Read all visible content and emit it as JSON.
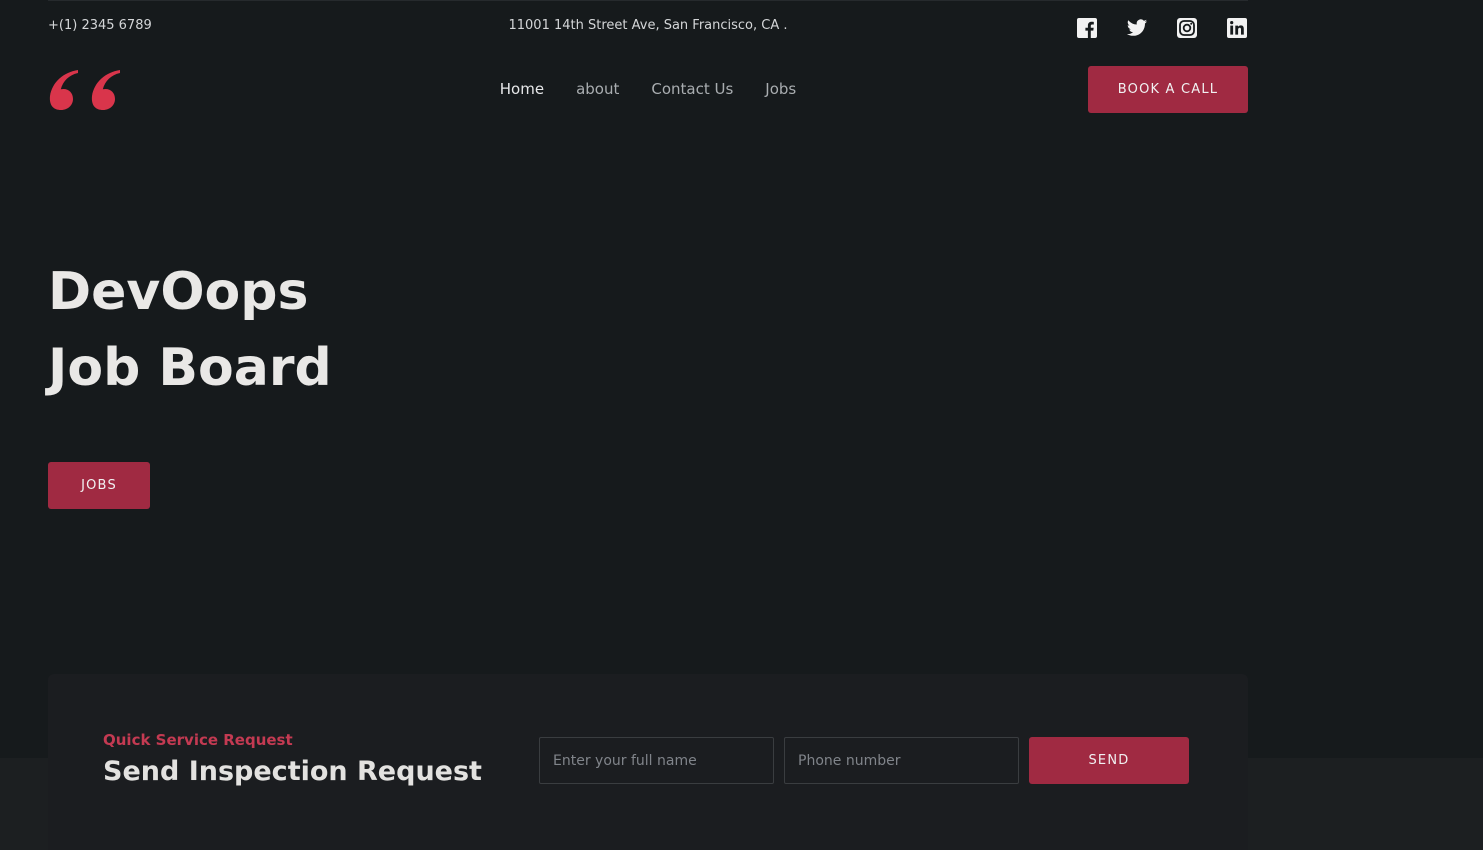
{
  "topbar": {
    "phone": "+(1) 2345 6789",
    "address": "11001 14th Street Ave, San Francisco, CA ."
  },
  "social_icons": [
    "facebook-icon",
    "twitter-icon",
    "instagram-icon",
    "linkedin-icon"
  ],
  "nav": {
    "items": [
      {
        "label": "Home",
        "active": true
      },
      {
        "label": "about",
        "active": false
      },
      {
        "label": "Contact Us",
        "active": false
      },
      {
        "label": "Jobs",
        "active": false
      }
    ],
    "cta_label": "BOOK A CALL"
  },
  "hero": {
    "title_line1": "DevOops",
    "title_line2": "Job Board",
    "button_label": "JOBS"
  },
  "request": {
    "eyebrow": "Quick Service Request",
    "title": "Send Inspection Request",
    "name_placeholder": "Enter your full name",
    "phone_placeholder": "Phone number",
    "send_label": "SEND"
  },
  "colors": {
    "background": "#161a1c",
    "accent": "#a02a42",
    "eyebrow": "#c43a52",
    "logo": "#d9354b"
  }
}
